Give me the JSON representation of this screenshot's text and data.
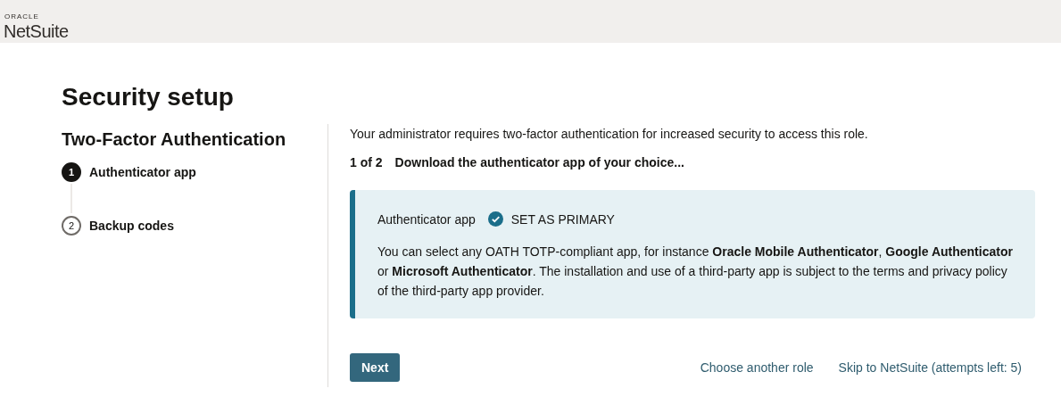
{
  "header": {
    "brand_top": "ORACLE",
    "brand": "NetSuite"
  },
  "title": "Security setup",
  "sidebar": {
    "heading": "Two-Factor Authentication",
    "steps": [
      {
        "number": "1",
        "label": "Authenticator app",
        "selected": true
      },
      {
        "number": "2",
        "label": "Backup codes",
        "selected": false
      }
    ]
  },
  "intro": "Your administrator requires two-factor authentication for increased security to access this role.",
  "step_counter": "1 of 2",
  "step_title": "Download the authenticator app of your choice...",
  "card": {
    "label": "Authenticator app",
    "primary": true,
    "primary_label": "SET AS PRIMARY",
    "text": "You can select any OATH TOTP-compliant app, for instance **Oracle Mobile Authenticator**, **Google Authenticator** or **Microsoft Authenticator**. The installation and use of a third-party app is subject to the terms and privacy policy of the third-party app provider."
  },
  "buttons": [
    {
      "kind": "primary",
      "label": "Next"
    },
    {
      "kind": "link",
      "label": "Choose another role"
    },
    {
      "kind": "link",
      "label": "Skip to NetSuite (attempts left: 5)"
    }
  ]
}
